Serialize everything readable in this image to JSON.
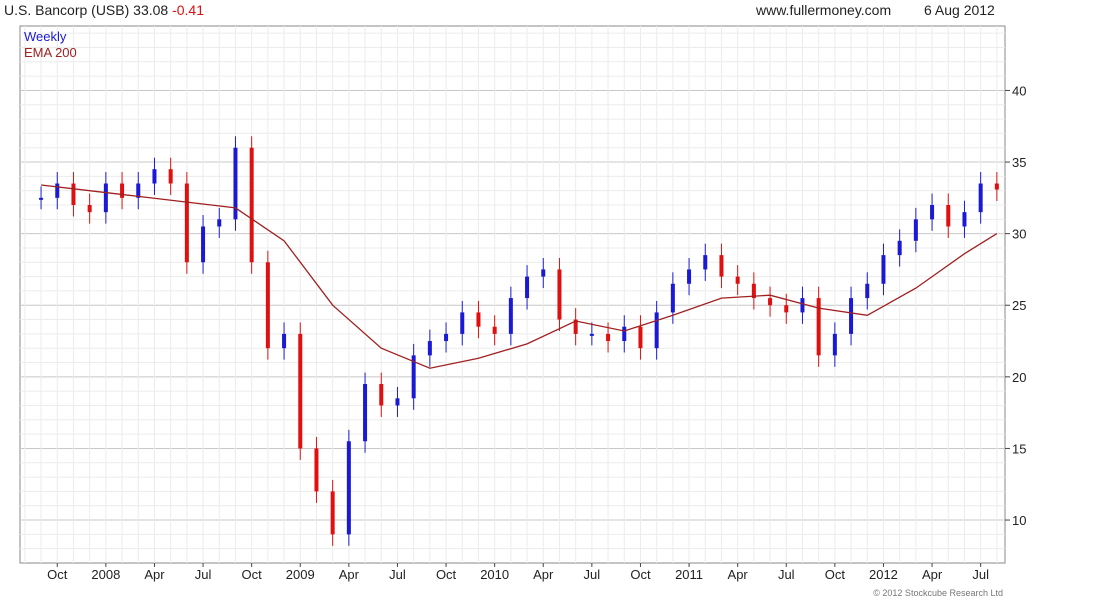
{
  "header": {
    "symbol": "U.S. Bancorp (USB) 33.08",
    "change": "-0.41",
    "site": "www.fullermoney.com",
    "date": "6 Aug 2012"
  },
  "colors": {
    "up": "#1a1ad6",
    "down": "#e01010",
    "ema": "#a02020",
    "grid": "#d9d9d9"
  },
  "footer": {
    "copyright": "© 2012 Stockcube Research Ltd"
  },
  "chart_data": {
    "type": "line",
    "title": "U.S. Bancorp (USB) 33.08 -0.41",
    "legend": [
      "Weekly",
      "EMA 200"
    ],
    "legend_position": "top-left",
    "grid": true,
    "ylim": [
      7,
      44.5
    ],
    "y_ticks": [
      10,
      15,
      20,
      25,
      30,
      35,
      40
    ],
    "x_ticks": [
      "Oct",
      "2008",
      "Apr",
      "Jul",
      "Oct",
      "2009",
      "Apr",
      "Jul",
      "Oct",
      "2010",
      "Apr",
      "Jul",
      "Oct",
      "2011",
      "Apr",
      "Jul",
      "Oct",
      "2012",
      "Apr",
      "Jul"
    ],
    "series": [
      {
        "name": "Weekly",
        "style": "candlestick",
        "x": [
          "2007-09",
          "2007-10",
          "2007-11",
          "2007-12",
          "2008-01",
          "2008-02",
          "2008-03",
          "2008-04",
          "2008-05",
          "2008-06",
          "2008-07",
          "2008-08",
          "2008-09",
          "2008-10",
          "2008-11",
          "2008-12",
          "2009-01",
          "2009-02",
          "2009-03",
          "2009-04",
          "2009-05",
          "2009-06",
          "2009-07",
          "2009-08",
          "2009-09",
          "2009-10",
          "2009-11",
          "2009-12",
          "2010-01",
          "2010-02",
          "2010-03",
          "2010-04",
          "2010-05",
          "2010-06",
          "2010-07",
          "2010-08",
          "2010-09",
          "2010-10",
          "2010-11",
          "2010-12",
          "2011-01",
          "2011-02",
          "2011-03",
          "2011-04",
          "2011-05",
          "2011-06",
          "2011-07",
          "2011-08",
          "2011-09",
          "2011-10",
          "2011-11",
          "2011-12",
          "2012-01",
          "2012-02",
          "2012-03",
          "2012-04",
          "2012-05",
          "2012-06",
          "2012-07",
          "2012-08"
        ],
        "values": [
          32.5,
          33.5,
          32.0,
          31.5,
          33.5,
          32.5,
          33.5,
          34.5,
          33.5,
          28.0,
          30.5,
          31.0,
          36.0,
          28.0,
          22.0,
          23.0,
          15.0,
          12.0,
          9.0,
          15.5,
          19.5,
          18.0,
          18.5,
          21.5,
          22.5,
          23.0,
          24.5,
          23.5,
          23.0,
          25.5,
          27.0,
          27.5,
          24.0,
          23.0,
          23.0,
          22.5,
          23.5,
          22.0,
          24.5,
          26.5,
          27.5,
          28.5,
          27.0,
          26.5,
          25.5,
          25.0,
          24.5,
          25.5,
          21.5,
          23.0,
          25.5,
          26.5,
          28.5,
          29.5,
          31.0,
          32.0,
          30.5,
          31.5,
          33.5,
          33.08
        ]
      },
      {
        "name": "EMA 200",
        "x": [
          "2007-09",
          "2007-12",
          "2008-03",
          "2008-06",
          "2008-09",
          "2008-12",
          "2009-03",
          "2009-06",
          "2009-09",
          "2009-12",
          "2010-03",
          "2010-06",
          "2010-09",
          "2010-12",
          "2011-03",
          "2011-06",
          "2011-09",
          "2011-12",
          "2012-03",
          "2012-06",
          "2012-08"
        ],
        "values": [
          33.4,
          33.0,
          32.6,
          32.2,
          31.8,
          29.5,
          25.0,
          22.0,
          20.6,
          21.3,
          22.3,
          23.9,
          23.2,
          24.3,
          25.5,
          25.7,
          24.8,
          24.3,
          26.2,
          28.6,
          30.0
        ]
      }
    ]
  }
}
